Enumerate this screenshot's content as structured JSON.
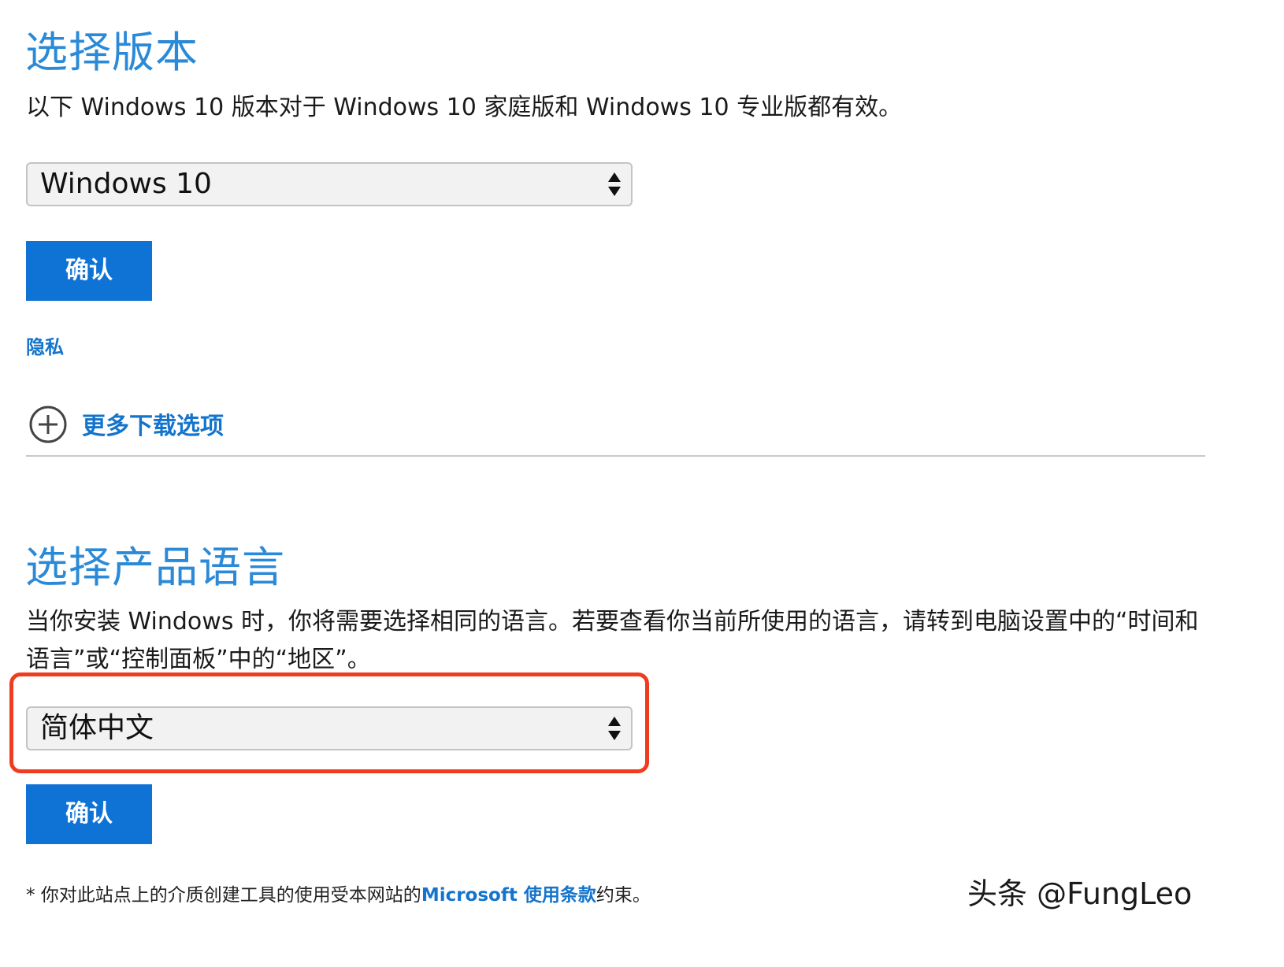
{
  "edition": {
    "heading": "选择版本",
    "description": "以下 Windows 10 版本对于 Windows 10 家庭版和 Windows 10 专业版都有效。",
    "select_value": "Windows 10",
    "confirm_label": "确认",
    "privacy_link": "隐私",
    "more_options_label": "更多下载选项"
  },
  "language": {
    "heading": "选择产品语言",
    "description": "当你安装 Windows 时，你将需要选择相同的语言。若要查看你当前所使用的语言，请转到电脑设置中的“时间和语言”或“控制面板”中的“地区”。",
    "select_value": "简体中文",
    "confirm_label": "确认"
  },
  "footer": {
    "prefix": "* 你对此站点上的介质创建工具的使用受本网站的",
    "terms_link": "Microsoft 使用条款",
    "suffix": "约束。"
  },
  "watermark": "头条 @FungLeo",
  "colors": {
    "heading": "#2b8ad7",
    "button": "#0f73d6",
    "link": "#1474cc",
    "highlight": "#f03c1e"
  },
  "icons": {
    "select_arrows": "up-down-arrows-icon",
    "more_options": "plus-circle-icon"
  }
}
